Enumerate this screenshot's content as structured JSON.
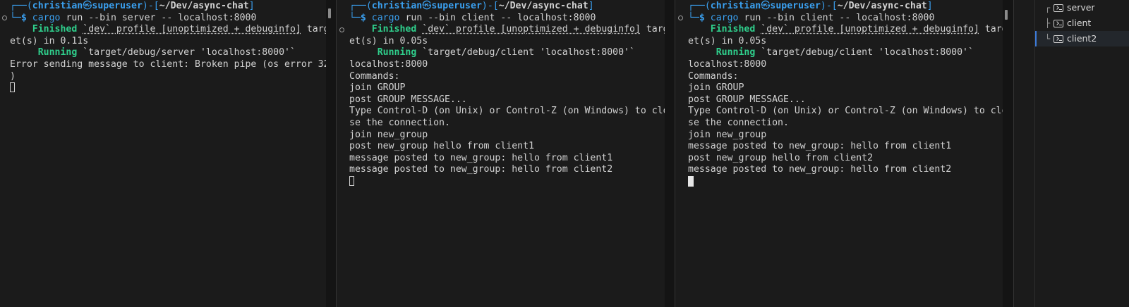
{
  "panes": [
    {
      "id": "server",
      "prompt": {
        "box_top_open": "┌──(",
        "user": "christian",
        "at_symbol": "㉿",
        "host": "superuser",
        "sep": ")-[",
        "path": "~/Dev/async-chat",
        "close": "]",
        "box_bottom": "└─",
        "dollar": "$",
        "command_name": "cargo",
        "command_args": " run --bin server -- localhost:8000"
      },
      "finished": {
        "label": "Finished",
        "profile": "`dev` profile [unoptimized + debuginfo]",
        "rest1": " targ",
        "wrap": "et(s) in 0.11s"
      },
      "running": {
        "label": "Running",
        "text": " `target/debug/server 'localhost:8000'`"
      },
      "lines": [
        "Error sending message to client: Broken pipe (os error 32",
        ")"
      ]
    },
    {
      "id": "client",
      "prompt": {
        "box_top_open": "┌──(",
        "user": "christian",
        "at_symbol": "㉿",
        "host": "superuser",
        "sep": ")-[",
        "path": "~/Dev/async-chat",
        "close": "]",
        "box_bottom": "└─",
        "dollar": "$",
        "command_name": "cargo",
        "command_args": " run --bin client -- localhost:8000"
      },
      "finished": {
        "label": "Finished",
        "profile": "`dev` profile [unoptimized + debuginfo]",
        "rest1": " targ",
        "wrap": "et(s) in 0.05s"
      },
      "running": {
        "label": "Running",
        "text": " `target/debug/client 'localhost:8000'`"
      },
      "lines": [
        "localhost:8000",
        "Commands:",
        "join GROUP",
        "post GROUP MESSAGE...",
        "Type Control-D (on Unix) or Control-Z (on Windows) to clo",
        "se the connection.",
        "join new_group",
        "post new_group hello from client1",
        "message posted to new_group: hello from client1",
        "message posted to new_group: hello from client2"
      ]
    },
    {
      "id": "client2",
      "prompt": {
        "box_top_open": "┌──(",
        "user": "christian",
        "at_symbol": "㉿",
        "host": "superuser",
        "sep": ")-[",
        "path": "~/Dev/async-chat",
        "close": "]",
        "box_bottom": "└─",
        "dollar": "$",
        "command_name": "cargo",
        "command_args": " run --bin client -- localhost:8000"
      },
      "finished": {
        "label": "Finished",
        "profile": "`dev` profile [unoptimized + debuginfo]",
        "rest1": " targ",
        "wrap": "et(s) in 0.05s"
      },
      "running": {
        "label": "Running",
        "text": " `target/debug/client 'localhost:8000'`"
      },
      "lines": [
        "localhost:8000",
        "Commands:",
        "join GROUP",
        "post GROUP MESSAGE...",
        "Type Control-D (on Unix) or Control-Z (on Windows) to clo",
        "se the connection.",
        "join new_group",
        "message posted to new_group: hello from client1",
        "post new_group hello from client2",
        "message posted to new_group: hello from client2"
      ]
    }
  ],
  "sidebar": {
    "items": [
      {
        "tree": "┌",
        "label": "server",
        "icon": "terminal-icon",
        "active": false
      },
      {
        "tree": "├",
        "label": "client",
        "icon": "terminal-icon",
        "active": false
      },
      {
        "tree": "└",
        "label": "client2",
        "icon": "terminal-icon",
        "active": true
      }
    ]
  },
  "colors": {
    "background": "#1b1b1b",
    "prompt_blue": "#3aa0f0",
    "finished_green": "#2fcf8c",
    "active_tab_accent": "#3d7bd9"
  }
}
